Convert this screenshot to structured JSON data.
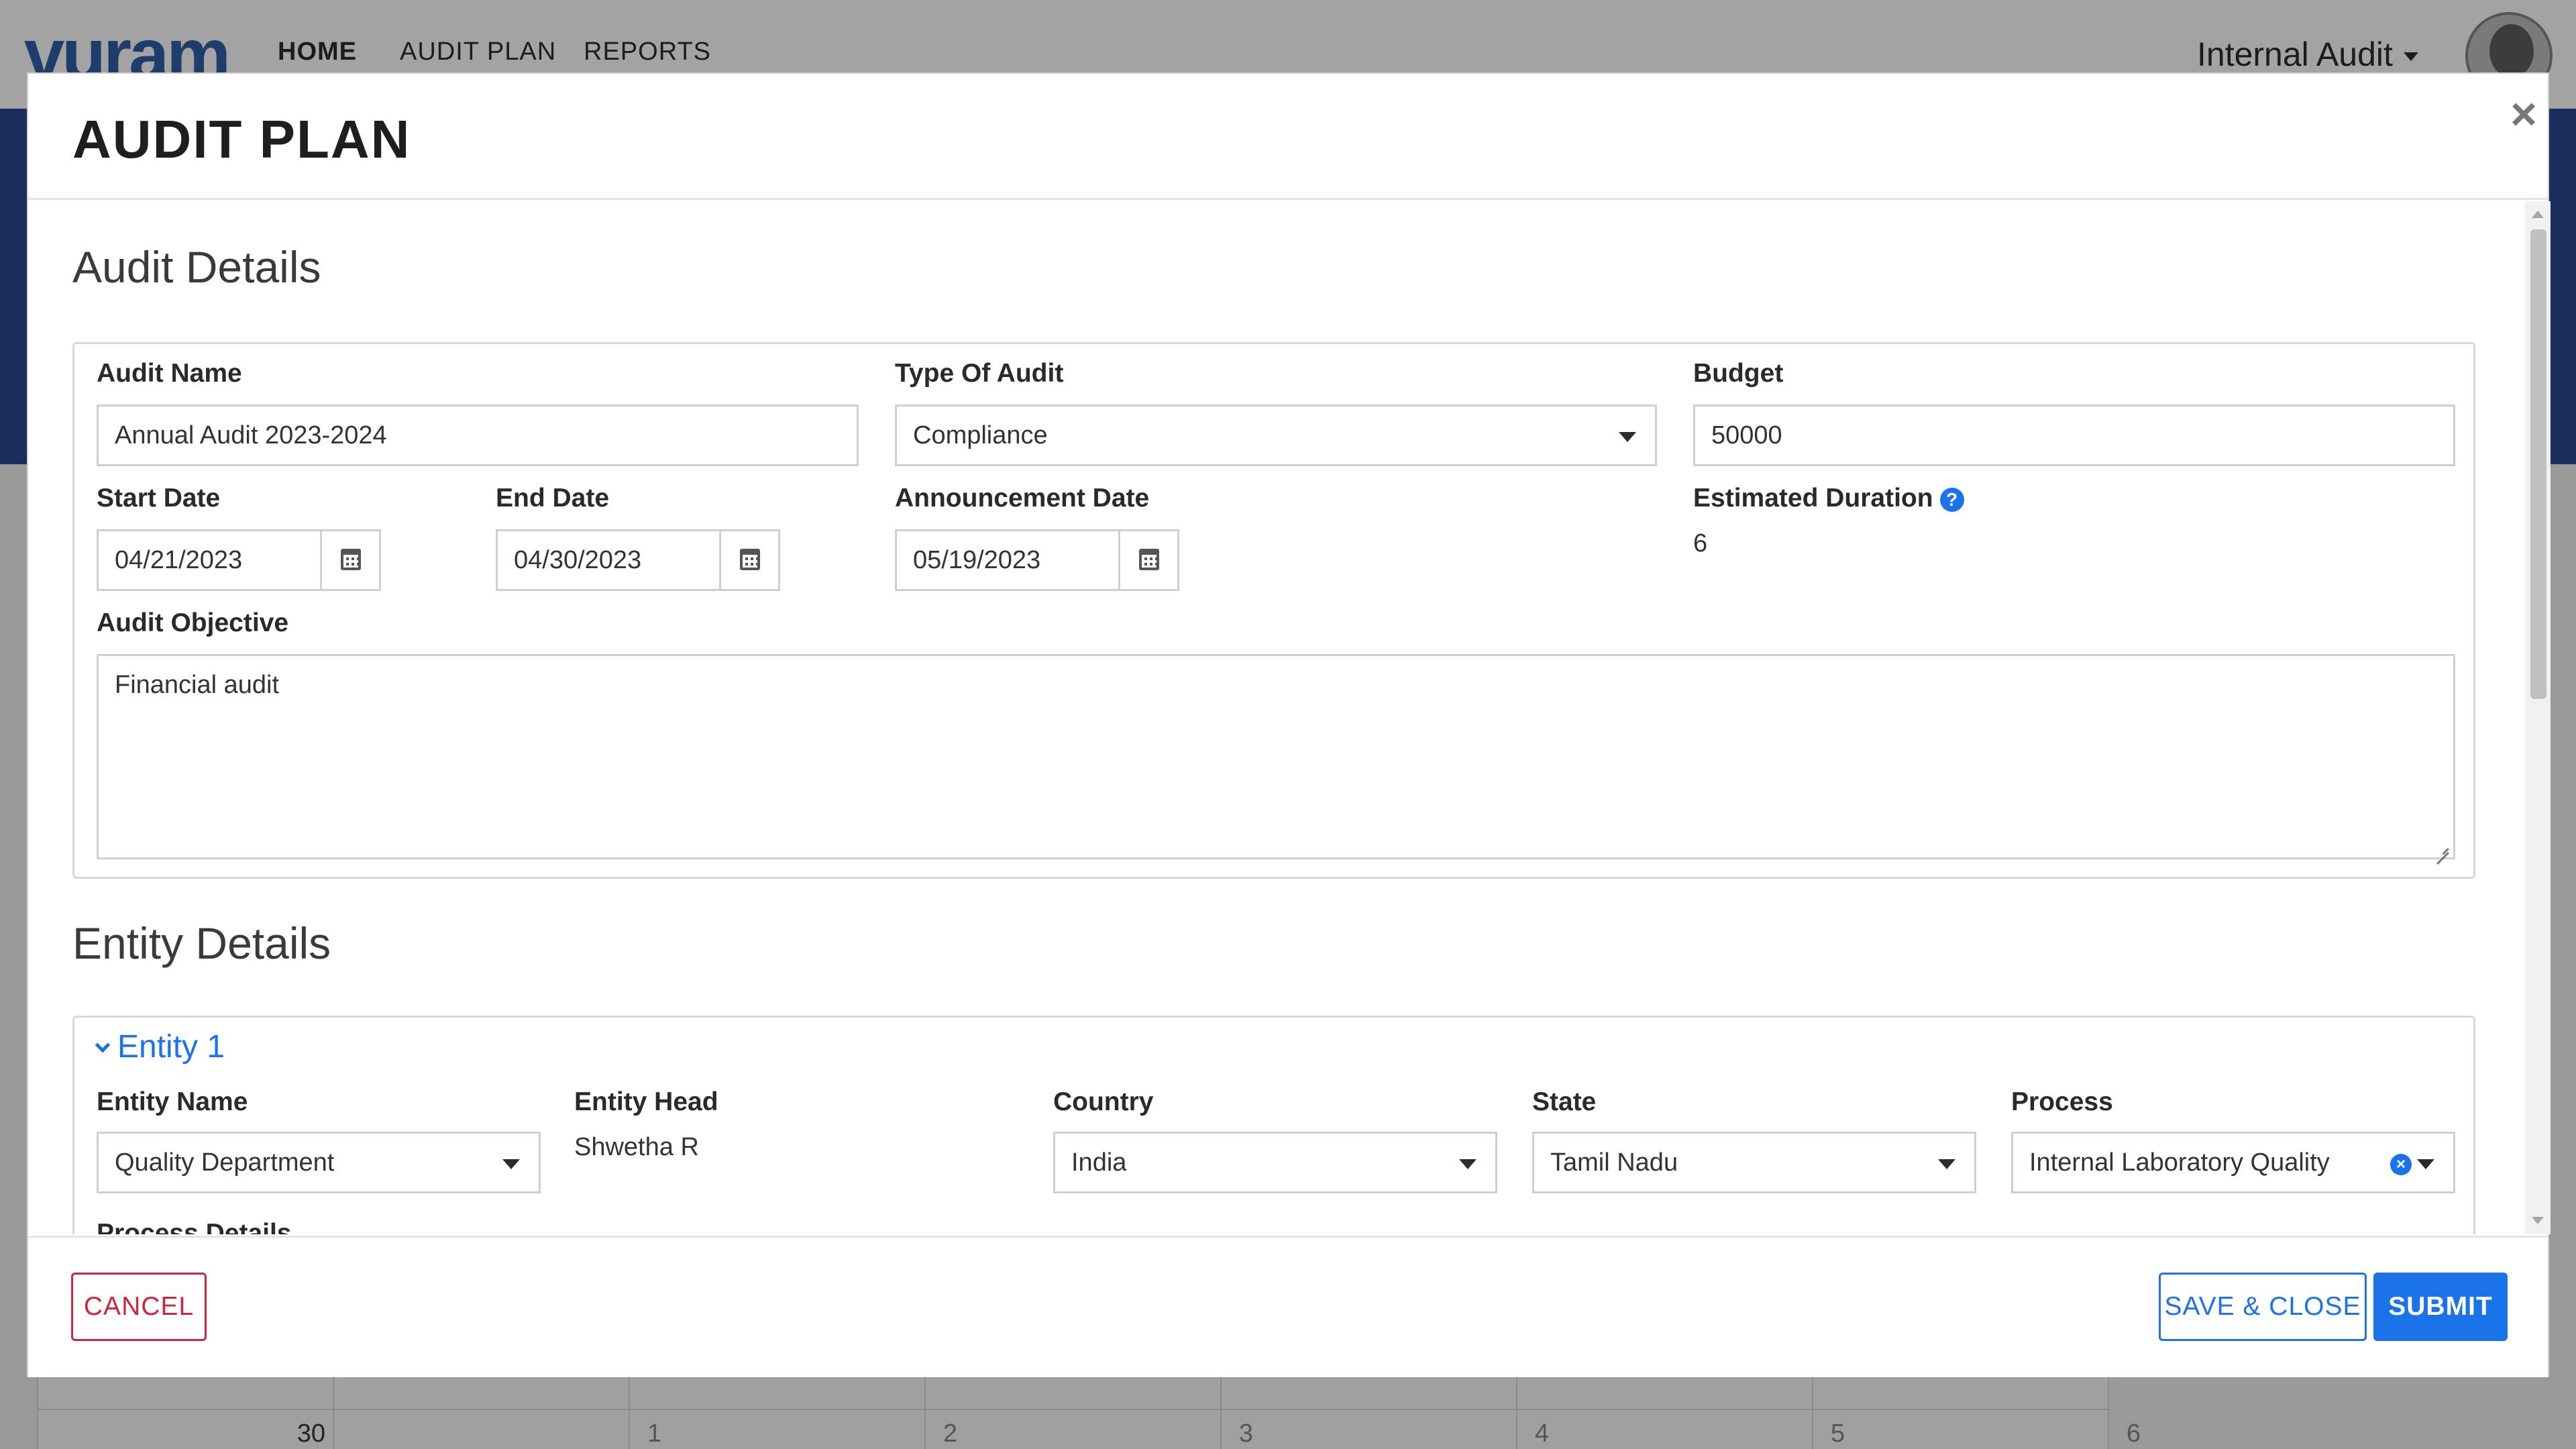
{
  "app": {
    "logo": "vuram",
    "nav": {
      "home": "HOME",
      "audit_plan": "AUDIT PLAN",
      "reports": "REPORTS"
    },
    "user_menu": "Internal Audit",
    "calendar_days": [
      "30",
      "1",
      "2",
      "3",
      "4",
      "5",
      "6"
    ]
  },
  "modal": {
    "title": "AUDIT PLAN",
    "close_icon": "×"
  },
  "audit_details": {
    "section_title": "Audit Details",
    "audit_name": {
      "label": "Audit Name",
      "value": "Annual Audit 2023-2024"
    },
    "type_of_audit": {
      "label": "Type Of Audit",
      "value": "Compliance"
    },
    "budget": {
      "label": "Budget",
      "value": "50000"
    },
    "start_date": {
      "label": "Start Date",
      "value": "04/21/2023"
    },
    "end_date": {
      "label": "End Date",
      "value": "04/30/2023"
    },
    "announcement_date": {
      "label": "Announcement Date",
      "value": "05/19/2023"
    },
    "estimated_duration": {
      "label": "Estimated Duration",
      "value": "6",
      "help_icon": "?"
    },
    "audit_objective": {
      "label": "Audit Objective",
      "value": "Financial audit"
    }
  },
  "entity_details": {
    "section_title": "Entity Details",
    "entity_1": {
      "toggle_label": "Entity 1",
      "entity_name": {
        "label": "Entity Name",
        "value": "Quality Department"
      },
      "entity_head": {
        "label": "Entity Head",
        "value": "Shwetha R"
      },
      "country": {
        "label": "Country",
        "value": "India"
      },
      "state": {
        "label": "State",
        "value": "Tamil Nadu"
      },
      "process": {
        "label": "Process",
        "value": "Internal Laboratory Quality",
        "clear_icon": "×"
      },
      "process_details": {
        "label": "Process Details"
      }
    }
  },
  "footer": {
    "cancel": "CANCEL",
    "save_close": "SAVE & CLOSE",
    "submit": "SUBMIT"
  }
}
